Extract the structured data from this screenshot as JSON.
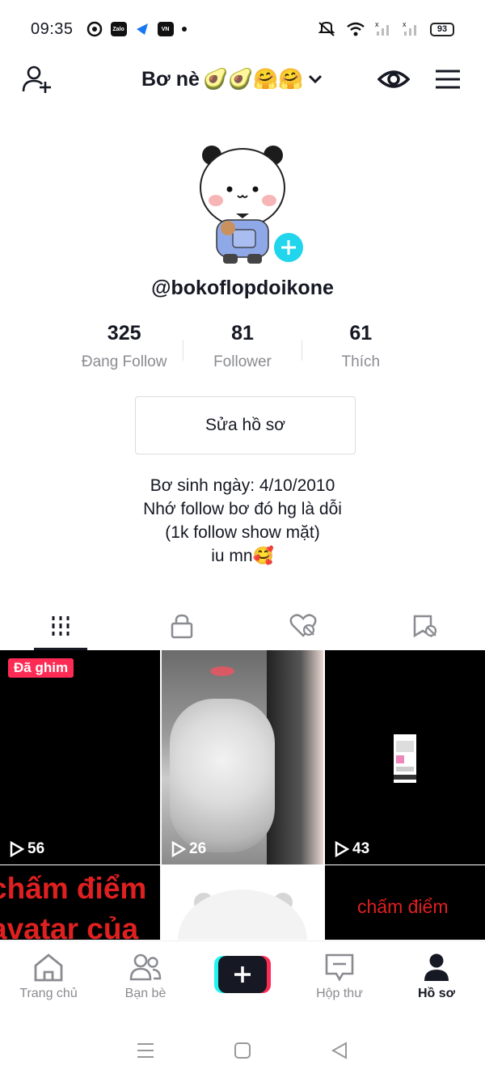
{
  "status_bar": {
    "time": "09:35",
    "apps": [
      "Zalo",
      "VN"
    ],
    "battery": "93"
  },
  "header": {
    "title": "Bơ nè",
    "title_emojis": "🥑🥑🤗🤗"
  },
  "profile": {
    "username": "@bokoflopdoikone",
    "stats": [
      {
        "value": "325",
        "label": "Đang Follow"
      },
      {
        "value": "81",
        "label": "Follower"
      },
      {
        "value": "61",
        "label": "Thích"
      }
    ],
    "edit_button": "Sửa hồ sơ",
    "bio_lines": [
      "Bơ sinh ngày: 4/10/2010",
      "Nhớ follow bơ đó hg là dỗi",
      "(1k follow show mặt)",
      "iu mn🥰"
    ]
  },
  "tabs": [
    "videos-tab",
    "private-tab",
    "liked-tab",
    "favorites-tab"
  ],
  "grid": {
    "pinned_label": "Đã ghim",
    "views": [
      "56",
      "26",
      "43"
    ],
    "cell4_lines": [
      "chấm điểm",
      "avatar của"
    ],
    "cell6_text": "chấm điểm"
  },
  "bottom_nav": {
    "home": "Trang chủ",
    "friends": "Bạn bè",
    "inbox": "Hộp thư",
    "profile": "Hồ sơ"
  },
  "colors": {
    "accent_red": "#fe2c55",
    "accent_cyan": "#25f4ee",
    "add_avatar": "#20d5ec"
  }
}
